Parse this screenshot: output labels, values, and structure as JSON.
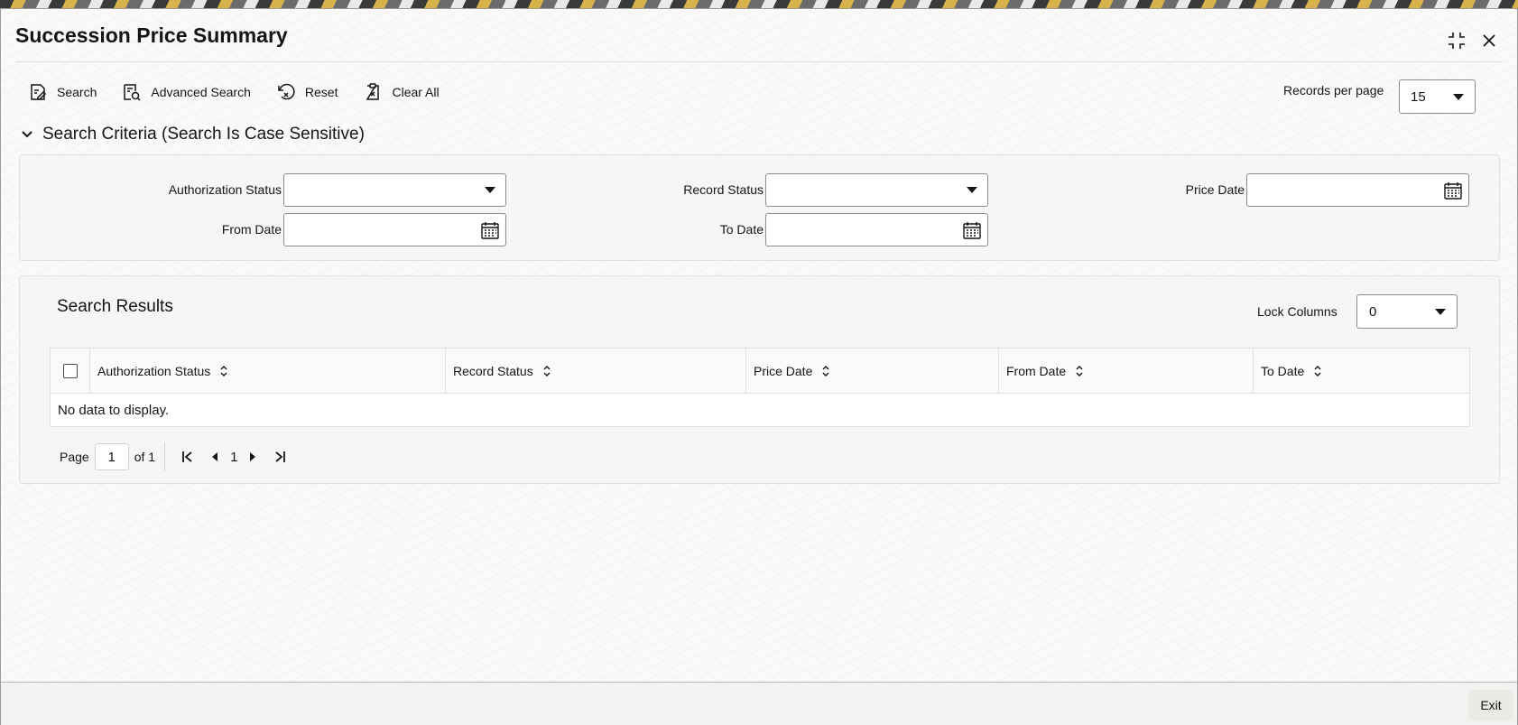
{
  "window": {
    "title": "Succession Price Summary"
  },
  "toolbar": {
    "search_label": "Search",
    "advanced_search_label": "Advanced Search",
    "reset_label": "Reset",
    "clear_all_label": "Clear All",
    "records_per_page_label": "Records per page",
    "records_per_page_value": "15"
  },
  "criteria": {
    "header": "Search Criteria (Search Is Case Sensitive)",
    "authorization_status_label": "Authorization Status",
    "authorization_status_value": "",
    "record_status_label": "Record Status",
    "record_status_value": "",
    "price_date_label": "Price Date",
    "price_date_value": "",
    "from_date_label": "From Date",
    "from_date_value": "",
    "to_date_label": "To Date",
    "to_date_value": ""
  },
  "results": {
    "title": "Search Results",
    "lock_columns_label": "Lock Columns",
    "lock_columns_value": "0",
    "columns": [
      "Authorization Status",
      "Record Status",
      "Price Date",
      "From Date",
      "To Date"
    ],
    "empty_message": "No data to display."
  },
  "pager": {
    "page_label": "Page",
    "page_value": "1",
    "of_label": "of 1",
    "current_page": "1"
  },
  "footer": {
    "exit_label": "Exit"
  },
  "colors": {
    "panel_bg": "#f7f6f5",
    "border": "#8f8c88",
    "text": "#161513"
  }
}
